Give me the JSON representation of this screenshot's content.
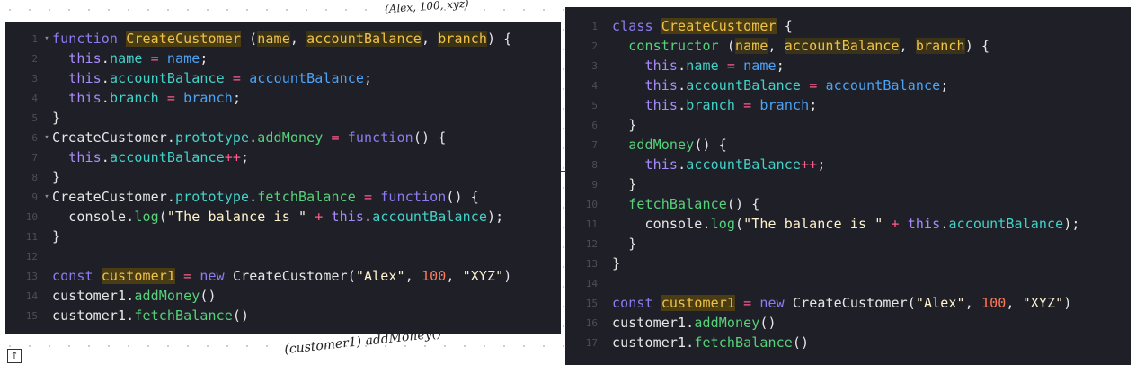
{
  "left_editor": {
    "lines": [
      {
        "n": "1",
        "fold": "▾",
        "tokens": [
          [
            "kw",
            "function "
          ],
          [
            "cls",
            "CreateCustomer"
          ],
          [
            "pl",
            " ("
          ],
          [
            "prm",
            "name"
          ],
          [
            "pl",
            ", "
          ],
          [
            "prm",
            "accountBalance"
          ],
          [
            "pl",
            ", "
          ],
          [
            "prm",
            "branch"
          ],
          [
            "pl",
            ") {"
          ]
        ]
      },
      {
        "n": "2",
        "fold": "",
        "tokens": [
          [
            "pl",
            "  "
          ],
          [
            "this",
            "this"
          ],
          [
            "pl",
            "."
          ],
          [
            "prop",
            "name"
          ],
          [
            "pl",
            " "
          ],
          [
            "op",
            "="
          ],
          [
            "pl",
            " "
          ],
          [
            "rhs",
            "name"
          ],
          [
            "pl",
            ";"
          ]
        ]
      },
      {
        "n": "3",
        "fold": "",
        "tokens": [
          [
            "pl",
            "  "
          ],
          [
            "this",
            "this"
          ],
          [
            "pl",
            "."
          ],
          [
            "prop",
            "accountBalance"
          ],
          [
            "pl",
            " "
          ],
          [
            "op",
            "="
          ],
          [
            "pl",
            " "
          ],
          [
            "rhs",
            "accountBalance"
          ],
          [
            "pl",
            ";"
          ]
        ]
      },
      {
        "n": "4",
        "fold": "",
        "tokens": [
          [
            "pl",
            "  "
          ],
          [
            "this",
            "this"
          ],
          [
            "pl",
            "."
          ],
          [
            "prop",
            "branch"
          ],
          [
            "pl",
            " "
          ],
          [
            "op",
            "="
          ],
          [
            "pl",
            " "
          ],
          [
            "rhs",
            "branch"
          ],
          [
            "pl",
            ";"
          ]
        ]
      },
      {
        "n": "5",
        "fold": "",
        "tokens": [
          [
            "pl",
            "}"
          ]
        ]
      },
      {
        "n": "6",
        "fold": "▾",
        "tokens": [
          [
            "pl",
            "CreateCustomer."
          ],
          [
            "prop",
            "prototype"
          ],
          [
            "pl",
            "."
          ],
          [
            "meth",
            "addMoney"
          ],
          [
            "pl",
            " "
          ],
          [
            "op",
            "="
          ],
          [
            "pl",
            " "
          ],
          [
            "kw",
            "function"
          ],
          [
            "pl",
            "() {"
          ]
        ]
      },
      {
        "n": "7",
        "fold": "",
        "tokens": [
          [
            "pl",
            "  "
          ],
          [
            "this",
            "this"
          ],
          [
            "pl",
            "."
          ],
          [
            "prop",
            "accountBalance"
          ],
          [
            "op",
            "++"
          ],
          [
            "pl",
            ";"
          ]
        ]
      },
      {
        "n": "8",
        "fold": "",
        "tokens": [
          [
            "pl",
            "}"
          ]
        ]
      },
      {
        "n": "9",
        "fold": "▾",
        "tokens": [
          [
            "pl",
            "CreateCustomer."
          ],
          [
            "prop",
            "prototype"
          ],
          [
            "pl",
            "."
          ],
          [
            "meth",
            "fetchBalance"
          ],
          [
            "pl",
            " "
          ],
          [
            "op",
            "="
          ],
          [
            "pl",
            " "
          ],
          [
            "kw",
            "function"
          ],
          [
            "pl",
            "() {"
          ]
        ]
      },
      {
        "n": "10",
        "fold": "",
        "tokens": [
          [
            "pl",
            "  console."
          ],
          [
            "meth",
            "log"
          ],
          [
            "pl",
            "("
          ],
          [
            "str",
            "\"The balance is \""
          ],
          [
            "pl",
            " "
          ],
          [
            "op",
            "+"
          ],
          [
            "pl",
            " "
          ],
          [
            "this",
            "this"
          ],
          [
            "pl",
            "."
          ],
          [
            "prop",
            "accountBalance"
          ],
          [
            "pl",
            ");"
          ]
        ]
      },
      {
        "n": "11",
        "fold": "",
        "tokens": [
          [
            "pl",
            "}"
          ]
        ]
      },
      {
        "n": "12",
        "fold": "",
        "tokens": []
      },
      {
        "n": "13",
        "fold": "",
        "tokens": [
          [
            "kw",
            "const "
          ],
          [
            "cls",
            "customer1"
          ],
          [
            "pl",
            " "
          ],
          [
            "op",
            "="
          ],
          [
            "pl",
            " "
          ],
          [
            "kw",
            "new"
          ],
          [
            "pl",
            " CreateCustomer("
          ],
          [
            "str",
            "\"Alex\""
          ],
          [
            "pl",
            ", "
          ],
          [
            "num",
            "100"
          ],
          [
            "pl",
            ", "
          ],
          [
            "str",
            "\"XYZ\""
          ],
          [
            "pl",
            ")"
          ]
        ]
      },
      {
        "n": "14",
        "fold": "",
        "tokens": [
          [
            "pl",
            "customer1."
          ],
          [
            "meth",
            "addMoney"
          ],
          [
            "pl",
            "()"
          ]
        ]
      },
      {
        "n": "15",
        "fold": "",
        "tokens": [
          [
            "pl",
            "customer1."
          ],
          [
            "meth",
            "fetchBalance"
          ],
          [
            "pl",
            "()"
          ]
        ]
      }
    ]
  },
  "right_editor": {
    "lines": [
      {
        "n": "1",
        "tokens": [
          [
            "kw",
            "class "
          ],
          [
            "cls",
            "CreateCustomer"
          ],
          [
            "pl",
            " {"
          ]
        ]
      },
      {
        "n": "2",
        "tokens": [
          [
            "pl",
            "  "
          ],
          [
            "meth",
            "constructor"
          ],
          [
            "pl",
            " ("
          ],
          [
            "prm",
            "name"
          ],
          [
            "pl",
            ", "
          ],
          [
            "prm",
            "accountBalance"
          ],
          [
            "pl",
            ", "
          ],
          [
            "prm",
            "branch"
          ],
          [
            "pl",
            ") {"
          ]
        ]
      },
      {
        "n": "3",
        "tokens": [
          [
            "pl",
            "    "
          ],
          [
            "this",
            "this"
          ],
          [
            "pl",
            "."
          ],
          [
            "prop",
            "name"
          ],
          [
            "pl",
            " "
          ],
          [
            "op",
            "="
          ],
          [
            "pl",
            " "
          ],
          [
            "rhs",
            "name"
          ],
          [
            "pl",
            ";"
          ]
        ]
      },
      {
        "n": "4",
        "tokens": [
          [
            "pl",
            "    "
          ],
          [
            "this",
            "this"
          ],
          [
            "pl",
            "."
          ],
          [
            "prop",
            "accountBalance"
          ],
          [
            "pl",
            " "
          ],
          [
            "op",
            "="
          ],
          [
            "pl",
            " "
          ],
          [
            "rhs",
            "accountBalance"
          ],
          [
            "pl",
            ";"
          ]
        ]
      },
      {
        "n": "5",
        "tokens": [
          [
            "pl",
            "    "
          ],
          [
            "this",
            "this"
          ],
          [
            "pl",
            "."
          ],
          [
            "prop",
            "branch"
          ],
          [
            "pl",
            " "
          ],
          [
            "op",
            "="
          ],
          [
            "pl",
            " "
          ],
          [
            "rhs",
            "branch"
          ],
          [
            "pl",
            ";"
          ]
        ]
      },
      {
        "n": "6",
        "tokens": [
          [
            "pl",
            "  }"
          ]
        ]
      },
      {
        "n": "7",
        "tokens": [
          [
            "pl",
            "  "
          ],
          [
            "meth",
            "addMoney"
          ],
          [
            "pl",
            "() {"
          ]
        ]
      },
      {
        "n": "8",
        "tokens": [
          [
            "pl",
            "    "
          ],
          [
            "this",
            "this"
          ],
          [
            "pl",
            "."
          ],
          [
            "prop",
            "accountBalance"
          ],
          [
            "op",
            "++"
          ],
          [
            "pl",
            ";"
          ]
        ]
      },
      {
        "n": "9",
        "tokens": [
          [
            "pl",
            "  }"
          ]
        ]
      },
      {
        "n": "10",
        "tokens": [
          [
            "pl",
            "  "
          ],
          [
            "meth",
            "fetchBalance"
          ],
          [
            "pl",
            "() {"
          ]
        ]
      },
      {
        "n": "11",
        "tokens": [
          [
            "pl",
            "    console."
          ],
          [
            "meth",
            "log"
          ],
          [
            "pl",
            "("
          ],
          [
            "str",
            "\"The balance is \""
          ],
          [
            "pl",
            " "
          ],
          [
            "op",
            "+"
          ],
          [
            "pl",
            " "
          ],
          [
            "this",
            "this"
          ],
          [
            "pl",
            "."
          ],
          [
            "prop",
            "accountBalance"
          ],
          [
            "pl",
            ");"
          ]
        ]
      },
      {
        "n": "12",
        "tokens": [
          [
            "pl",
            "  }"
          ]
        ]
      },
      {
        "n": "13",
        "tokens": [
          [
            "pl",
            "}"
          ]
        ]
      },
      {
        "n": "14",
        "tokens": []
      },
      {
        "n": "15",
        "tokens": [
          [
            "kw",
            "const "
          ],
          [
            "cls",
            "customer1"
          ],
          [
            "pl",
            " "
          ],
          [
            "op",
            "="
          ],
          [
            "pl",
            " "
          ],
          [
            "kw",
            "new"
          ],
          [
            "pl",
            " CreateCustomer("
          ],
          [
            "str",
            "\"Alex\""
          ],
          [
            "pl",
            ", "
          ],
          [
            "num",
            "100"
          ],
          [
            "pl",
            ", "
          ],
          [
            "str",
            "\"XYZ\""
          ],
          [
            "pl",
            ")"
          ]
        ]
      },
      {
        "n": "16",
        "tokens": [
          [
            "pl",
            "customer1."
          ],
          [
            "meth",
            "addMoney"
          ],
          [
            "pl",
            "()"
          ]
        ]
      },
      {
        "n": "17",
        "tokens": [
          [
            "pl",
            "customer1."
          ],
          [
            "meth",
            "fetchBalance"
          ],
          [
            "pl",
            "()"
          ]
        ]
      }
    ]
  },
  "annotations": {
    "top_scribble": "(Alex, 100, xyz)",
    "bottom_scribble": "(customer1) addMoney()"
  },
  "export_icon": "↑",
  "colors": {
    "editor_bg": "#1e1f27",
    "keyword": "#8c7cf0",
    "highlight": "#f0c24a",
    "property": "#43d2c8",
    "string": "#fff2cc",
    "number": "#ff7a59",
    "operator": "#ff5c8a",
    "method": "#56d27a"
  }
}
